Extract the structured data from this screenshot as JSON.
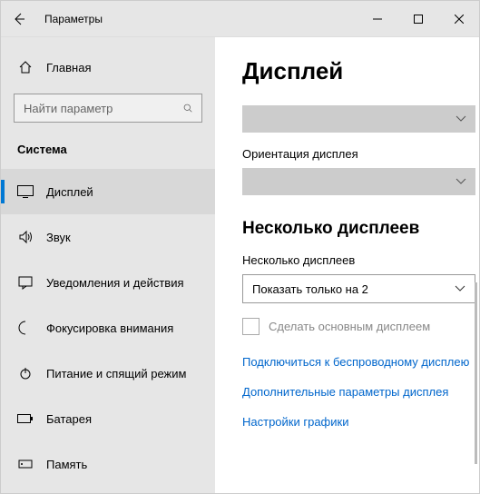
{
  "window": {
    "title": "Параметры"
  },
  "sidebar": {
    "home": "Главная",
    "search_placeholder": "Найти параметр",
    "section": "Система",
    "items": [
      {
        "label": "Дисплей"
      },
      {
        "label": "Звук"
      },
      {
        "label": "Уведомления и действия"
      },
      {
        "label": "Фокусировка внимания"
      },
      {
        "label": "Питание и спящий режим"
      },
      {
        "label": "Батарея"
      },
      {
        "label": "Память"
      }
    ]
  },
  "main": {
    "heading": "Дисплей",
    "orientation_label": "Ориентация дисплея",
    "multi_heading": "Несколько дисплеев",
    "multi_label": "Несколько дисплеев",
    "multi_select_value": "Показать только на 2",
    "make_main_label": "Сделать основным дисплеем",
    "links": {
      "connect": "Подключиться к беспроводному дисплею",
      "advanced": "Дополнительные параметры дисплея",
      "graphics": "Настройки графики"
    }
  }
}
